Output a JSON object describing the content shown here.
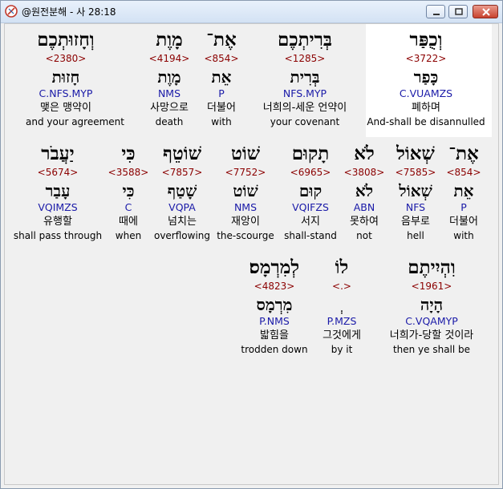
{
  "window": {
    "title": "@원전분해 - 사 28:18"
  },
  "rows": [
    [
      {
        "heb": "וְחָזוּתְכֶם",
        "strong": "<2380>",
        "lex": "חָזוּת",
        "parse": "C.NFS.MYP",
        "kor": "맺은 맹약이",
        "eng": "and your agreement"
      },
      {
        "heb": "מָוֶת",
        "strong": "<4194>",
        "lex": "מָוֶת",
        "parse": "NMS",
        "kor": "사망으로",
        "eng": "death"
      },
      {
        "heb": "אֶת־",
        "strong": "<854>",
        "lex": "אֵת",
        "parse": "P",
        "kor": "더불어",
        "eng": "with"
      },
      {
        "heb": "בְּרִיתְכֶם",
        "strong": "<1285>",
        "lex": "בְּרִית",
        "parse": "NFS.MYP",
        "kor": "너희의-세운 언약이",
        "eng": "your covenant"
      },
      {
        "heb": "וְכֻפַּר",
        "strong": "<3722>",
        "lex": "כָּפַר",
        "parse": "C.VUAMZS",
        "kor": "폐하며",
        "eng": "And-shall be disannulled"
      }
    ],
    [
      {
        "heb": "יַעֲבֹר",
        "strong": "<5674>",
        "lex": "עָבַר",
        "parse": "VQIMZS",
        "kor": "유행할",
        "eng": "shall pass through"
      },
      {
        "heb": "כִּי",
        "strong": "<3588>",
        "lex": "כִּי",
        "parse": "C",
        "kor": "때에",
        "eng": "when"
      },
      {
        "heb": "שׁוֹטֵף",
        "strong": "<7857>",
        "lex": "שָׁטַף",
        "parse": "VQPA",
        "kor": "넘치는",
        "eng": "overflowing"
      },
      {
        "heb": "שׁוֹט",
        "strong": "<7752>",
        "lex": "שׁוֹט",
        "parse": "NMS",
        "kor": "재앙이",
        "eng": "the-scourge"
      },
      {
        "heb": "תָקוּם",
        "strong": "<6965>",
        "lex": "קוּם",
        "parse": "VQIFZS",
        "kor": "서지",
        "eng": "shall-stand"
      },
      {
        "heb": "לֹא",
        "strong": "<3808>",
        "lex": "לֹא",
        "parse": "ABN",
        "kor": "못하여",
        "eng": "not"
      },
      {
        "heb": "שְׁאוֹל",
        "strong": "<7585>",
        "lex": "שְׁאוֹל",
        "parse": "NFS",
        "kor": "음부로",
        "eng": "hell"
      },
      {
        "heb": "אֶת־",
        "strong": "<854>",
        "lex": "אֵת",
        "parse": "P",
        "kor": "더불어",
        "eng": "with"
      }
    ],
    [
      {
        "heb": "לְמִרְמָס׃",
        "strong": "<4823>",
        "lex": "מִרְמָס",
        "parse": "P.NMS",
        "kor": "밟힘을",
        "eng": "trodden down"
      },
      {
        "heb": "לוֹ",
        "strong": "<.>",
        "lex": "ְ",
        "parse": "P.MZS",
        "kor": "그것에게",
        "eng": "by it"
      },
      {
        "heb": "וִהְיִיתֶם",
        "strong": "<1961>",
        "lex": "הָיָה",
        "parse": "C.VQAMYP",
        "kor": "너희가-당할 것이라",
        "eng": "then ye shall be"
      }
    ]
  ]
}
